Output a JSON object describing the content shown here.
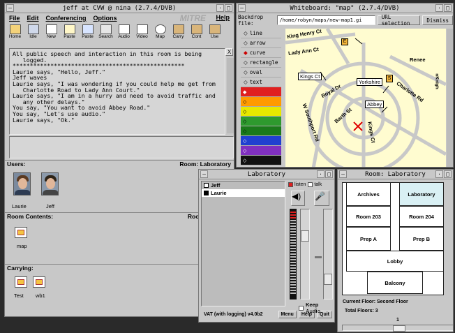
{
  "jeff_window": {
    "title": "jeff at CVW @ nina (2.7.4/DVB)",
    "menus": [
      "File",
      "Edit",
      "Conferencing",
      "Options"
    ],
    "brand": "MITRE",
    "help": "Help",
    "tools": [
      "Home",
      "Idle",
      "New",
      "Paste",
      "Paste",
      "Search",
      "Audio",
      "Video",
      "Map",
      "Carry",
      "Cont",
      "Use"
    ],
    "chat_log": "All public speech and interaction in this room is being\n   logged.\n**************************************************\nLaurie says, \"Hello, Jeff.\"\nJeff waves\nLaurie says, \"I was wondering if you could help me get from\n   Charlotte Road to Lady Ann Court.\"\nLaurie says, \"I am in a hurry and need to avoid traffic and\n   any other delays.\"\nYou say, \"You want to avoid Abbey Road.\"\nYou say, \"Let's use audio.\"\nLaurie says, \"Ok.\"",
    "chat_close": "X",
    "users_label": "Users:",
    "room_label": "Room: Laboratory",
    "users": [
      "Laurie",
      "Jeff"
    ],
    "room_contents_label": "Room Contents:",
    "room_contents_room": "Room",
    "contents": [
      "map"
    ],
    "carrying_label": "Carrying:",
    "carrying": [
      "Test",
      "wb1"
    ]
  },
  "whiteboard": {
    "title": "Whiteboard: \"map\" (2.7.4/DVB)",
    "backdrop_label": "Backdrop file:",
    "backdrop_value": "/home/robyn/maps/new-map1.gi",
    "url_button": "URL selection",
    "dismiss_button": "Dismiss",
    "tools": [
      "line",
      "arrow",
      "curve",
      "rectangle",
      "oval",
      "text"
    ],
    "colors": [
      "#e02020",
      "#ff9a00",
      "#e8e800",
      "#2e9a2e",
      "#1a7a1a",
      "#2040d0",
      "#8030c0",
      "#111111"
    ],
    "map_labels": {
      "king_henry": "King Henry Ct",
      "lady_ann": "Lady Ann Ct",
      "kings_ct_box": "Kings Ct",
      "yorkshire": "Yorkshire",
      "abbey": "Abbey",
      "royal_dr": "Royal Dr",
      "w_southport": "W Southport Rd",
      "barth_st": "Barth St",
      "kings_ct_road": "Kings Ct",
      "renee": "Renee",
      "charlotte": "Charlotte Rd",
      "nknight": "nKnigh",
      "marker_e": "E",
      "marker_s": "S"
    }
  },
  "lab": {
    "title": "Laboratory",
    "users": [
      "Jeff",
      "Laurie"
    ],
    "listen": "listen",
    "talk": "talk",
    "keep_audio": "Keep Audio",
    "vat_label": "VAT (with logging) v4.0b2",
    "menu_button": "Menu",
    "help_button": "Help",
    "quit_button": "Quit"
  },
  "room": {
    "title": "Room: Laboratory",
    "rooms": [
      "Archives",
      "Laboratory",
      "Room 203",
      "Room 204",
      "Prep A",
      "Prep B",
      "Lobby",
      "Balcony"
    ],
    "current_floor": "Current Floor: Second Floor",
    "total_floors": "Total Floors: 3",
    "slider_value": "1"
  }
}
